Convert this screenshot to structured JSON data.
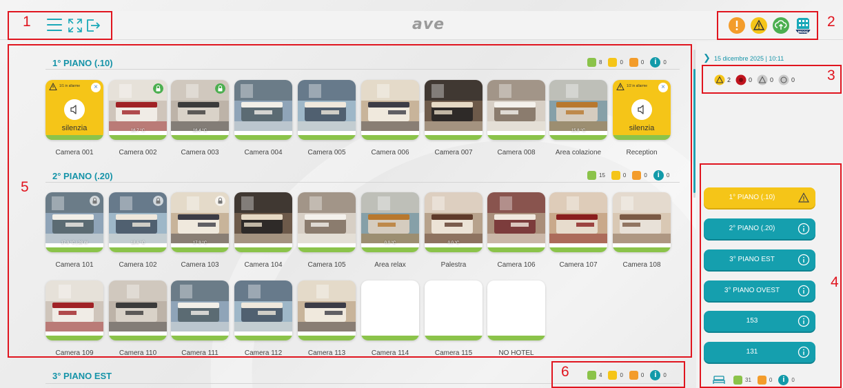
{
  "header": {
    "logo": "ave",
    "annot_left": "1",
    "annot_right": "2"
  },
  "colors": {
    "accent": "#19a8b8",
    "green": "#8bc34a",
    "yellow": "#f5c518",
    "orange": "#f39c2b",
    "red_annotation": "#e0141e"
  },
  "annotations": [
    "1",
    "2",
    "3",
    "4",
    "5",
    "6"
  ],
  "sections": [
    {
      "title": "1° PIANO (.10)",
      "green": "8",
      "yellow": "0",
      "orange": "0",
      "info": "0"
    },
    {
      "title": "2° PIANO (.20)",
      "green": "15",
      "yellow": "0",
      "orange": "0",
      "info": "0"
    },
    {
      "title": "3° PIANO EST",
      "green": "4",
      "yellow": "0",
      "orange": "0",
      "info": "0"
    }
  ],
  "floor1": [
    {
      "name": "Camera 001",
      "alarm": true,
      "alarm_text": "1/1 in allarme",
      "label": "silenzia"
    },
    {
      "name": "Camera 002",
      "temp": "16.7 °C",
      "lock": "green"
    },
    {
      "name": "Camera 003",
      "temp": "16.4 °C",
      "lock": "green"
    },
    {
      "name": "Camera 004"
    },
    {
      "name": "Camera 005"
    },
    {
      "name": "Camera 006"
    },
    {
      "name": "Camera 007"
    },
    {
      "name": "Camera 008"
    },
    {
      "name": "Area colazione",
      "temp": "15.8 °C"
    },
    {
      "name": "Reception",
      "alarm": true,
      "alarm_text": "1/2 in allarme",
      "label": "silenzia"
    }
  ],
  "floor2": [
    {
      "name": "Camera 101",
      "temp": "17.9 °C  |  28 W",
      "lock": "grey"
    },
    {
      "name": "Camera 102",
      "temp": "18.6 °C",
      "lock": "grey"
    },
    {
      "name": "Camera 103",
      "temp": "17.9 °C",
      "lock": "grey"
    },
    {
      "name": "Camera 104"
    },
    {
      "name": "Camera 105"
    },
    {
      "name": "Area relax",
      "temp": "0.0 °C"
    },
    {
      "name": "Palestra",
      "temp": "0.0 °C"
    },
    {
      "name": "Camera 106"
    },
    {
      "name": "Camera 107"
    },
    {
      "name": "Camera 108"
    },
    {
      "name": "Camera 109"
    },
    {
      "name": "Camera 110"
    },
    {
      "name": "Camera 111"
    },
    {
      "name": "Camera 112"
    },
    {
      "name": "Camera 113"
    },
    {
      "name": "Camera 114",
      "empty": true
    },
    {
      "name": "Camera 115",
      "empty": true
    },
    {
      "name": "NO HOTEL",
      "empty": true
    }
  ],
  "right_panel": {
    "date": "15 dicembre 2025 | 10:11",
    "alarm_counts": [
      "2",
      "0",
      "0",
      "0"
    ],
    "floors": [
      {
        "label": "1° PIANO (.10)",
        "state": "warning"
      },
      {
        "label": "2° PIANO (.20)",
        "state": "info"
      },
      {
        "label": "3° PIANO EST",
        "state": "info"
      },
      {
        "label": "3° PIANO OVEST",
        "state": "info"
      },
      {
        "label": "153",
        "state": "info"
      },
      {
        "label": "131",
        "state": "info"
      }
    ],
    "totals": {
      "green": "31",
      "orange": "0",
      "info": "0"
    }
  }
}
